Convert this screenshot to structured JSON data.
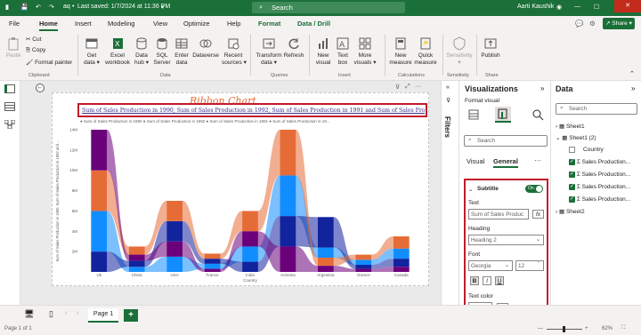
{
  "titlebar": {
    "save_tip": "Save",
    "undo_tip": "Undo",
    "redo_tip": "Redo",
    "file_name": "aq",
    "last_saved": "Last saved: 1/7/2024 at 11:36 PM",
    "search_placeholder": "Search",
    "user_name": "Aarti Kaushik"
  },
  "menu": {
    "tabs": [
      "File",
      "Home",
      "Insert",
      "Modeling",
      "View",
      "Optimize",
      "Help",
      "Format",
      "Data / Drill"
    ],
    "active": "Home",
    "share_label": "Share"
  },
  "ribbon": {
    "clipboard": {
      "paste": "Paste",
      "cut": "Cut",
      "copy": "Copy",
      "format_painter": "Format painter",
      "group": "Clipboard"
    },
    "data": {
      "get_data": [
        "Get",
        "data"
      ],
      "excel": [
        "Excel",
        "workbook"
      ],
      "data_hub": [
        "Data",
        "hub"
      ],
      "sql": [
        "SQL",
        "Server"
      ],
      "enter_data": [
        "Enter",
        "data"
      ],
      "dataverse": "Dataverse",
      "recent": [
        "Recent",
        "sources"
      ],
      "group": "Data"
    },
    "queries": {
      "transform": [
        "Transform",
        "data"
      ],
      "refresh": "Refresh",
      "group": "Queries"
    },
    "insert": {
      "new_visual": [
        "New",
        "visual"
      ],
      "text_box": [
        "Text",
        "box"
      ],
      "more_visuals": [
        "More",
        "visuals"
      ],
      "group": "Insert"
    },
    "calculations": {
      "new_measure": [
        "New",
        "measure"
      ],
      "quick_measure": [
        "Quick",
        "measure"
      ],
      "group": "Calculations"
    },
    "sensitivity": {
      "label": "Sensitivity",
      "group": "Sensitivity"
    },
    "share": {
      "publish": "Publish",
      "group": "Share"
    }
  },
  "report": {
    "chart_title": "Ribbon Chart",
    "subtitle": "Sum of Sales Production in 1990, Sum of Sales Production in 1992, Sum of Sales Production in 1991 and Sum of Sales Production in 19...",
    "legend": "● Sum of Sales Production in 1990  ● Sum of Sales Production in 1992  ● Sum of Sales Production in 1991  ● Sum of Sales Production in 19..."
  },
  "chart_data": {
    "type": "ribbon",
    "title": "Ribbon Chart",
    "xlabel": "Country",
    "ylabel": "Sum of Sales Production in 1990, Sum of Sales Production in 1992 and ...",
    "categories": [
      "Uk",
      "China",
      "USA",
      "France",
      "India",
      "Armenia",
      "Argentina",
      "Greece",
      "Canada"
    ],
    "yticks": [
      "2M",
      "4M",
      "6M",
      "8M",
      "10M",
      "12M",
      "14M"
    ],
    "ylim": [
      0,
      14
    ],
    "series": [
      {
        "name": "Sum of Sales Production in 1990",
        "color": "#118dff",
        "values": [
          4.0,
          0.5,
          1.5,
          0.5,
          1.5,
          4.0,
          1.0,
          0.5,
          1.0
        ]
      },
      {
        "name": "Sum of Sales Production in 1992",
        "color": "#12239e",
        "values": [
          2.0,
          0.6,
          2.0,
          0.5,
          1.0,
          3.0,
          3.0,
          0.4,
          0.8
        ]
      },
      {
        "name": "Sum of Sales Production in 1991",
        "color": "#e66c37",
        "values": [
          4.0,
          0.8,
          2.0,
          0.5,
          2.0,
          4.5,
          0.8,
          0.5,
          1.2
        ]
      },
      {
        "name": "Sum of Sales Production in 19...",
        "color": "#6b007b",
        "values": [
          4.0,
          0.6,
          1.5,
          0.3,
          1.5,
          2.5,
          0.6,
          0.3,
          0.5
        ]
      }
    ]
  },
  "filters": {
    "label": "Filters"
  },
  "visualizations": {
    "header": "Visualizations",
    "format_visual": "Format visual",
    "search_placeholder": "Search",
    "tab_visual": "Visual",
    "tab_general": "General",
    "more": "···",
    "subtitle_section": {
      "title": "Subtitle",
      "toggle": "On",
      "text_label": "Text",
      "text_value": "Sum of Sales Produc",
      "heading_label": "Heading",
      "heading_value": "Heading 2",
      "font_label": "Font",
      "font_value": "Georgia",
      "font_size": "12",
      "bold": "B",
      "italic": "I",
      "underline": "U",
      "text_color_label": "Text color",
      "text_color": "#3b46b7",
      "fx": "fx"
    }
  },
  "data_pane": {
    "header": "Data",
    "search_placeholder": "Search",
    "tables": [
      {
        "name": "Sheet1",
        "expanded": false
      },
      {
        "name": "Sheet1 (2)",
        "expanded": true,
        "fields": [
          {
            "name": "Country",
            "checked": false,
            "sigma": false
          },
          {
            "name": "Sales Production...",
            "checked": true,
            "sigma": true
          },
          {
            "name": "Sales Production...",
            "checked": true,
            "sigma": true
          },
          {
            "name": "Sales Production...",
            "checked": true,
            "sigma": true
          },
          {
            "name": "Sales Production...",
            "checked": true,
            "sigma": true
          }
        ]
      },
      {
        "name": "Sheet2",
        "expanded": false
      }
    ]
  },
  "bottom": {
    "page_tab": "Page 1",
    "add_page": "+"
  },
  "status": {
    "page": "Page 1 of 1",
    "zoom": "62%"
  }
}
